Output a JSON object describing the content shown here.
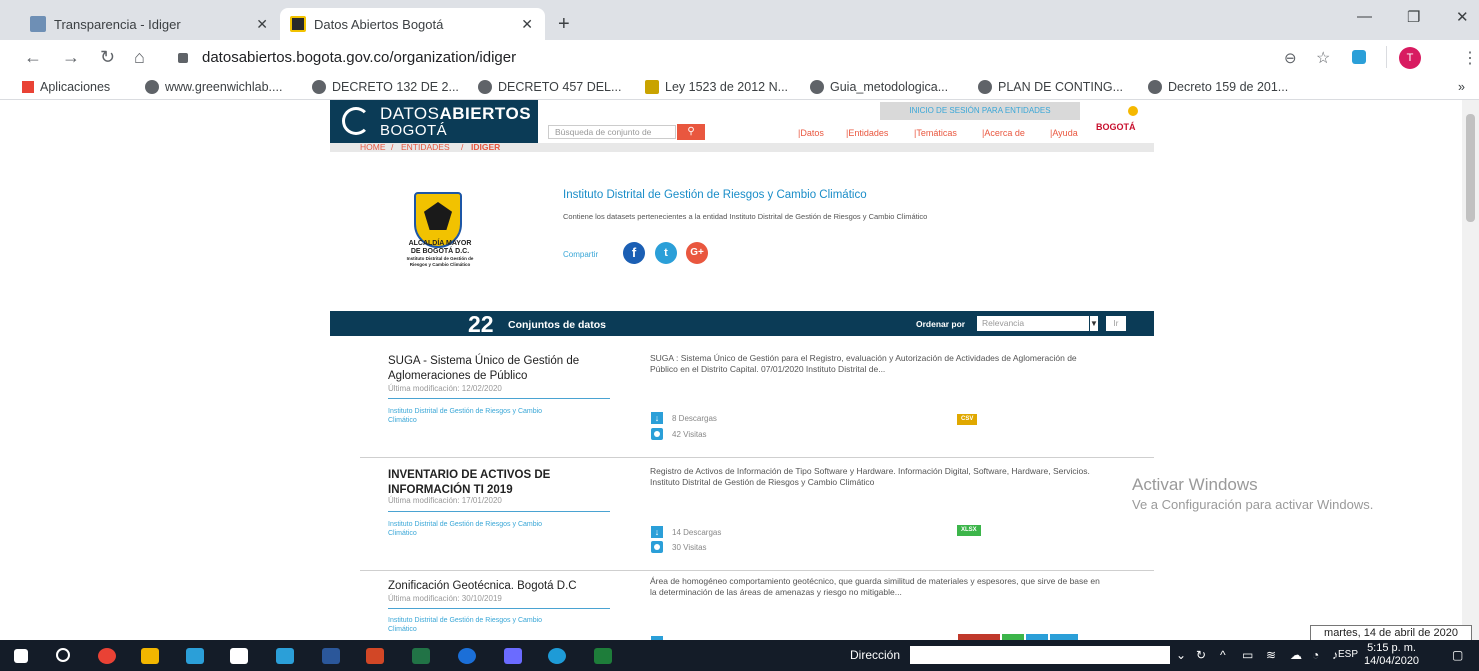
{
  "browser": {
    "tabs": [
      {
        "label": "Transparencia - Idiger",
        "active": false
      },
      {
        "label": "Datos Abiertos Bogotá",
        "active": true
      }
    ],
    "new_tab": "+",
    "url": "datosabiertos.bogota.gov.co/organization/idiger",
    "bookmarks": [
      "Aplicaciones",
      "www.greenwichlab....",
      "DECRETO 132 DE 2...",
      "DECRETO 457 DEL...",
      "Ley 1523 de 2012 N...",
      "Guia_metodologica...",
      "PLAN DE CONTING...",
      "Decreto 159 de 201..."
    ],
    "bookmarks_more": "»",
    "profile_initial": "T"
  },
  "site": {
    "logo_line1_light": "DATOS",
    "logo_line1_bold": "ABIERTOS",
    "logo_line2": "BOGOTÁ",
    "login_label": "INICIO DE SESIÓN PARA ENTIDADES",
    "search_placeholder": "Búsqueda de conjunto de",
    "nav": [
      "Datos",
      "Entidades",
      "Temáticas",
      "Acerca de",
      "Ayuda"
    ],
    "brand": "BOGOTÁ",
    "breadcrumb": [
      "HOME",
      "ENTIDADES",
      "IDIGER"
    ]
  },
  "org": {
    "caption_line1": "ALCALDÍA MAYOR",
    "caption_line2": "DE BOGOTÁ D.C.",
    "caption_line3": "Instituto Distrital de Gestión de",
    "caption_line4": "Riesgos y Cambio Climático",
    "title": "Instituto Distrital de Gestión de Riesgos y Cambio Climático",
    "description": "Contiene los datasets pertenecientes a la entidad Instituto Distrital de Gestión de Riesgos y Cambio Climático",
    "share_label": "Compartir"
  },
  "results": {
    "count": "22",
    "label": "Conjuntos de datos",
    "sort_label": "Ordenar por",
    "sort_value": "Relevancia",
    "go_label": "Ir"
  },
  "datasets": [
    {
      "title": "SUGA - Sistema Único de Gestión de Aglomeraciones de Público",
      "modified": "Última modificación: 12/02/2020",
      "org": "Instituto Distrital de Gestión de Riesgos y Cambio Climático",
      "description": "SUGA : Sistema Único de Gestión para el Registro, evaluación y Autorización de Actividades de Aglomeración de Público en el Distrito Capital. 07/01/2020 Instituto Distrital de...",
      "downloads": "8 Descargas",
      "views": "42 Visitas",
      "formats": [
        {
          "label": "CSV",
          "color": "#e0a800"
        }
      ]
    },
    {
      "title": "INVENTARIO DE ACTIVOS DE INFORMACIÓN TI 2019",
      "modified": "Última modificación: 17/01/2020",
      "org": "Instituto Distrital de Gestión de Riesgos y Cambio Climático",
      "description": "Registro de Activos de Información de Tipo Software y Hardware. Información Digital, Software, Hardware, Servicios. Instituto Distrital de Gestión de Riesgos y Cambio Climático",
      "downloads": "14 Descargas",
      "views": "30 Visitas",
      "formats": [
        {
          "label": "XLSX",
          "color": "#3cb54a"
        }
      ]
    },
    {
      "title": "Zonificación Geotécnica. Bogotá D.C",
      "modified": "Última modificación: 30/10/2019",
      "org": "Instituto Distrital de Gestión de Riesgos y Cambio Climático",
      "description": "Área de homogéneo comportamiento geotécnico, que guarda similitud de materiales y espesores, que sirve de base en la determinación de las áreas de amenazas y riesgo no mitigable...",
      "downloads": "",
      "views": "",
      "formats": [
        {
          "label": "",
          "color": "#c0392b"
        },
        {
          "label": "",
          "color": "#3cb54a"
        },
        {
          "label": "",
          "color": "#2b9fd8"
        },
        {
          "label": "",
          "color": "#2b9fd8"
        }
      ]
    }
  ],
  "windows": {
    "activate_title": "Activar Windows",
    "activate_sub": "Ve a Configuración para activar Windows.",
    "tooltip": "martes, 14 de abril de 2020",
    "address_label": "Dirección",
    "lang": "ESP",
    "time": "5:15 p. m.",
    "date": "14/04/2020"
  },
  "colors": {
    "brand_navy": "#0b3b56",
    "accent_orange": "#e9573f",
    "link_blue": "#1a8dc8"
  }
}
